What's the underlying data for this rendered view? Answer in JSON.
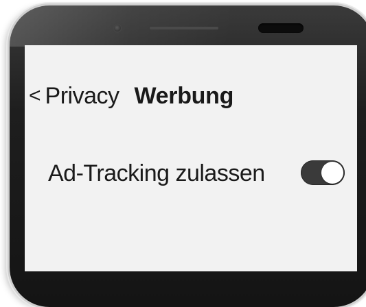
{
  "navigation": {
    "back_chevron": "<",
    "back_label": "Privacy",
    "title": "Werbung"
  },
  "settings": {
    "ad_tracking": {
      "label": "Ad-Tracking zulassen",
      "enabled": true
    }
  },
  "icons": {
    "camera": "front-camera-icon",
    "speaker": "earpiece-speaker-icon"
  },
  "colors": {
    "toggle_on": "#3a3a3a",
    "screen_bg": "#f2f2f2",
    "text": "#1a1a1a"
  }
}
